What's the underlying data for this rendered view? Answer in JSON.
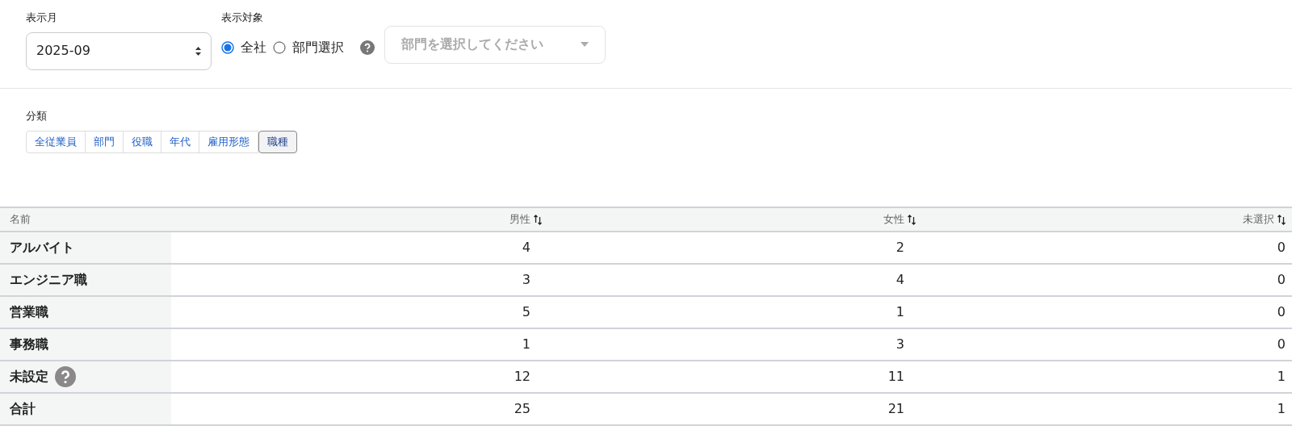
{
  "month": {
    "label": "表示月",
    "value": "2025-09"
  },
  "target": {
    "label": "表示対象",
    "options": [
      {
        "label": "全社",
        "selected": true
      },
      {
        "label": "部門選択",
        "selected": false
      }
    ],
    "department": {
      "placeholder": "部門を選択してください"
    }
  },
  "category": {
    "label": "分類",
    "tabs": [
      {
        "label": "全従業員",
        "selected": false
      },
      {
        "label": "部門",
        "selected": false
      },
      {
        "label": "役職",
        "selected": false
      },
      {
        "label": "年代",
        "selected": false
      },
      {
        "label": "雇用形態",
        "selected": false
      },
      {
        "label": "職種",
        "selected": true
      }
    ]
  },
  "table": {
    "columns": [
      "名前",
      "男性",
      "女性",
      "未選択"
    ],
    "rows": [
      {
        "name": "アルバイト",
        "help": false,
        "values": [
          "4",
          "2",
          "0"
        ]
      },
      {
        "name": "エンジニア職",
        "help": false,
        "values": [
          "3",
          "4",
          "0"
        ]
      },
      {
        "name": "営業職",
        "help": false,
        "values": [
          "5",
          "1",
          "0"
        ]
      },
      {
        "name": "事務職",
        "help": false,
        "values": [
          "1",
          "3",
          "0"
        ]
      },
      {
        "name": "未設定",
        "help": true,
        "values": [
          "12",
          "11",
          "1"
        ]
      },
      {
        "name": "合計",
        "help": false,
        "values": [
          "25",
          "21",
          "1"
        ]
      }
    ]
  }
}
